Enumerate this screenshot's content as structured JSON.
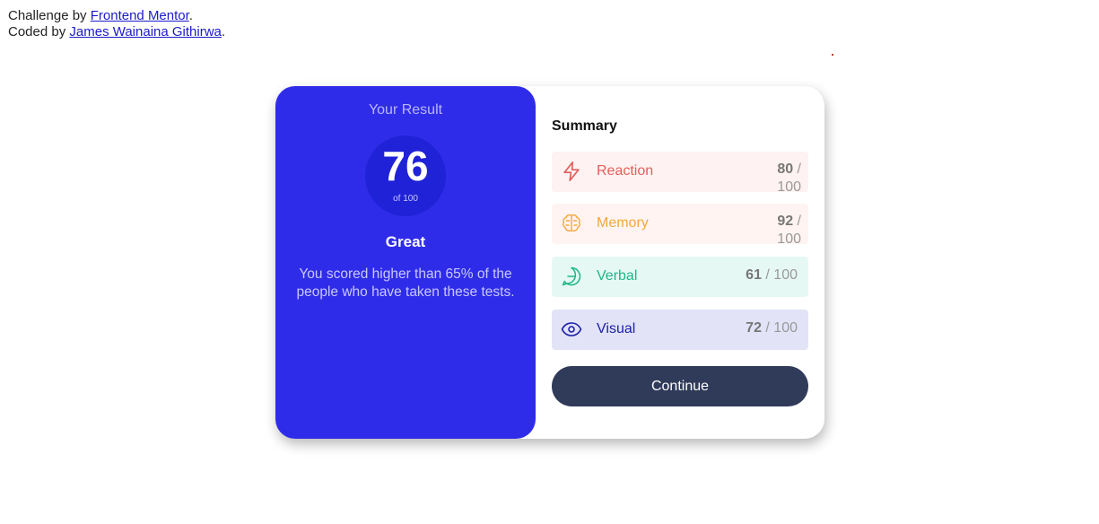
{
  "attribution": {
    "challenge_prefix": "Challenge by ",
    "challenge_link": "Frontend Mentor",
    "challenge_suffix": ".",
    "coded_prefix": "Coded by ",
    "coded_link": "James Wainaina Githirwa",
    "coded_suffix": "."
  },
  "result": {
    "title": "Your Result",
    "score": "76",
    "out_of": "of 100",
    "rating": "Great",
    "description": "You scored higher than 65% of the people who have taken these tests."
  },
  "summary": {
    "title": "Summary",
    "items": [
      {
        "label": "Reaction",
        "score": "80",
        "max": " / 100",
        "icon": "lightning-icon",
        "color": "#e35f5b"
      },
      {
        "label": "Memory",
        "score": "92",
        "max": " / 100",
        "icon": "brain-icon",
        "color": "#f3a83f"
      },
      {
        "label": "Verbal",
        "score": "61",
        "max": " / 100",
        "icon": "chat-icon",
        "color": "#1eb787"
      },
      {
        "label": "Visual",
        "score": "72",
        "max": " / 100",
        "icon": "eye-icon",
        "color": "#1d21a8"
      }
    ],
    "continue_label": "Continue"
  },
  "colors": {
    "result_bg": "#2f2ce9",
    "button_bg": "#303b5a"
  }
}
